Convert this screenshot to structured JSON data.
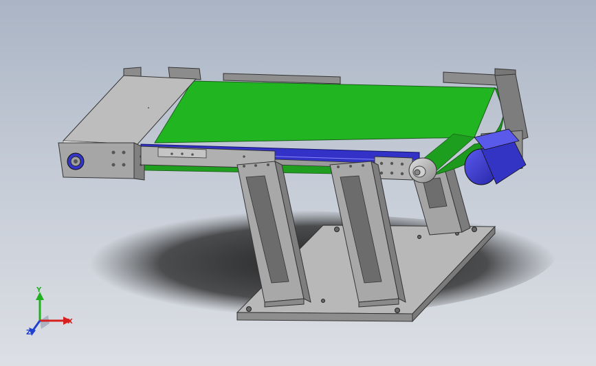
{
  "triad": {
    "x_label": "X",
    "y_label": "Y",
    "z_label": "Z"
  },
  "colors": {
    "belt": "#22b522",
    "steel": "#9a9a9a",
    "motor": "#3a3ad6",
    "axis_x": "#d62020",
    "axis_y": "#20b020",
    "axis_z": "#2040d0"
  },
  "icons": {
    "triad": "view-orientation-triad-icon"
  }
}
